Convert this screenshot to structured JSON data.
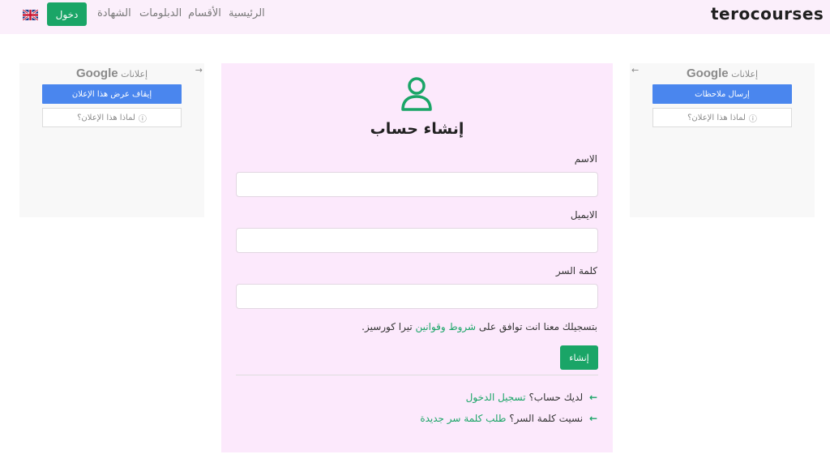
{
  "header": {
    "logo": "terocourses",
    "nav": [
      "الرئيسية",
      "الأقسام",
      "الدبلومات",
      "الشهادة"
    ],
    "login_label": "دخول",
    "language_icon": "uk-flag-icon"
  },
  "ads": {
    "left": {
      "header_label": "إعلانات",
      "brand": "Google",
      "primary_button": "إيقاف عرض هذا الإعلان",
      "secondary_button": "لماذا هذا الإعلان؟"
    },
    "right": {
      "header_label": "إعلانات",
      "brand": "Google",
      "primary_button": "إرسال ملاحظات",
      "secondary_button": "لماذا هذا الإعلان؟"
    }
  },
  "form": {
    "title": "إنشاء حساب",
    "name_label": "الاسم",
    "email_label": "الايميل",
    "password_label": "كلمة السر",
    "terms_prefix": "بتسجيلك معنا انت توافق على",
    "terms_link": "شروط وقوانين",
    "terms_suffix": "تيرا كورسيز.",
    "create_button": "إنشاء",
    "have_account": "لديك حساب؟",
    "login_link": "تسجيل الدخول",
    "forgot_password": "نسيت كلمة السر؟",
    "reset_link": "طلب كلمة سر جديدة"
  },
  "colors": {
    "accent": "#1aa567",
    "header_bg": "#fbeffb",
    "card_bg": "#fce9fc",
    "ad_button": "#4a86ee"
  }
}
